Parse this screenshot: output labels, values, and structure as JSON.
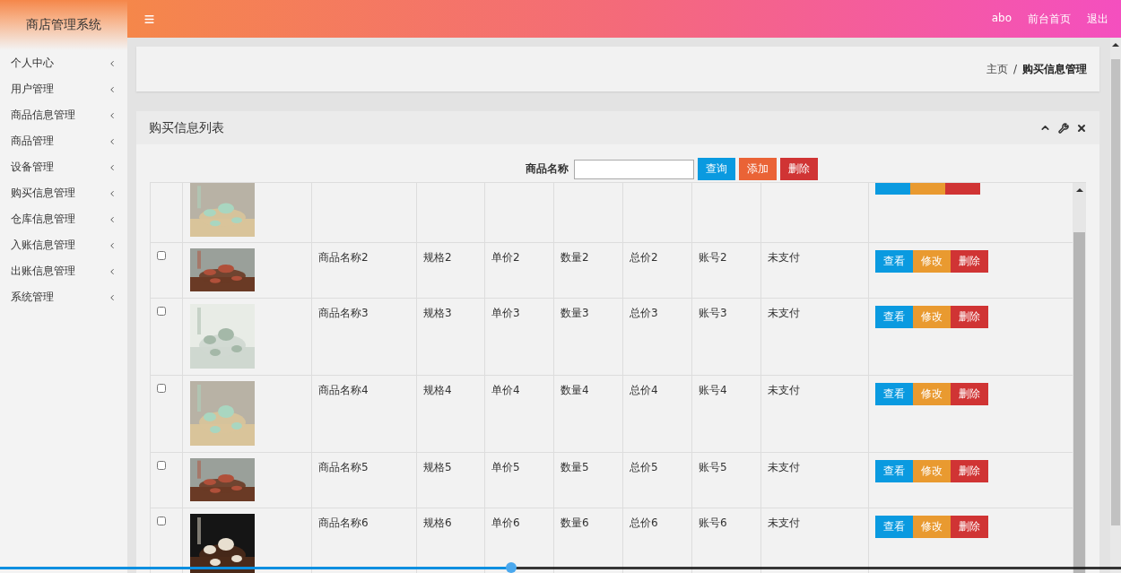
{
  "sidebar": {
    "title": "商店管理系统",
    "items": [
      {
        "label": "个人中心",
        "expanded": false
      },
      {
        "label": "用户管理",
        "expanded": false
      },
      {
        "label": "商品信息管理",
        "expanded": false
      },
      {
        "label": "商品管理",
        "expanded": false
      },
      {
        "label": "设备管理",
        "expanded": false
      },
      {
        "label": "购买信息管理",
        "expanded": false
      },
      {
        "label": "仓库信息管理",
        "expanded": false
      },
      {
        "label": "入账信息管理",
        "expanded": false
      },
      {
        "label": "出账信息管理",
        "expanded": false
      },
      {
        "label": "系统管理",
        "expanded": false
      }
    ]
  },
  "topbar": {
    "user": "abo",
    "links": [
      "前台首页",
      "退出"
    ]
  },
  "breadcrumb": [
    "主页",
    "/",
    "购买信息管理"
  ],
  "panel": {
    "title": "购买信息列表",
    "search": {
      "label": "商品名称"
    },
    "buttons": [
      {
        "label": "查询",
        "kind": "search"
      },
      {
        "label": "添加",
        "kind": "add"
      },
      {
        "label": "删除",
        "kind": "delete"
      }
    ],
    "rows": [
      {
        "kind": "clipped"
      },
      {
        "kind": "full",
        "checked": false,
        "cells": [
          "商品名称2",
          "规格2",
          "单价2",
          "数量2",
          "总价2",
          "账号2",
          "未支付"
        ],
        "actions": [
          {
            "label": "查看",
            "kind": "view"
          },
          {
            "label": "修改",
            "kind": "edit"
          },
          {
            "label": "删除",
            "kind": "delete"
          }
        ]
      },
      {
        "kind": "full",
        "checked": false,
        "cells": [
          "商品名称3",
          "规格3",
          "单价3",
          "数量3",
          "总价3",
          "账号3",
          "未支付"
        ],
        "actions": [
          {
            "label": "查看",
            "kind": "view"
          },
          {
            "label": "修改",
            "kind": "edit"
          },
          {
            "label": "删除",
            "kind": "delete"
          }
        ]
      },
      {
        "kind": "full",
        "checked": false,
        "cells": [
          "商品名称4",
          "规格4",
          "单价4",
          "数量4",
          "总价4",
          "账号4",
          "未支付"
        ],
        "actions": [
          {
            "label": "查看",
            "kind": "view"
          },
          {
            "label": "修改",
            "kind": "edit"
          },
          {
            "label": "删除",
            "kind": "delete"
          }
        ]
      },
      {
        "kind": "full",
        "checked": false,
        "cells": [
          "商品名称5",
          "规格5",
          "单价5",
          "数量5",
          "总价5",
          "账号5",
          "未支付"
        ],
        "actions": [
          {
            "label": "查看",
            "kind": "view"
          },
          {
            "label": "修改",
            "kind": "edit"
          },
          {
            "label": "删除",
            "kind": "delete"
          }
        ]
      },
      {
        "kind": "full",
        "checked": false,
        "cells": [
          "商品名称6",
          "规格6",
          "单价6",
          "数量6",
          "总价6",
          "账号6",
          "未支付"
        ],
        "actions": [
          {
            "label": "查看",
            "kind": "view"
          },
          {
            "label": "修改",
            "kind": "edit"
          },
          {
            "label": "删除",
            "kind": "delete"
          }
        ]
      }
    ]
  },
  "video_progress": {
    "level": 0.456
  }
}
